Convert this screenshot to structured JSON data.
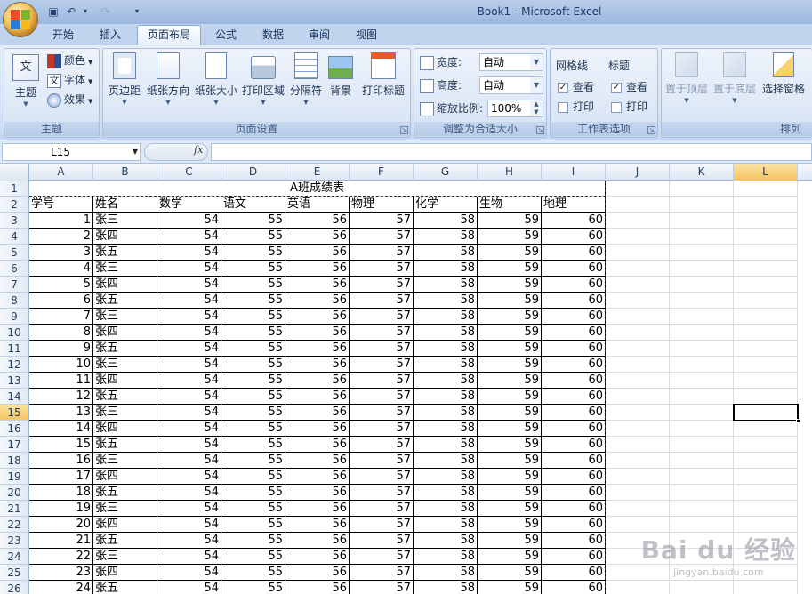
{
  "window": {
    "title": "Book1 - Microsoft Excel"
  },
  "tabs": [
    "开始",
    "插入",
    "页面布局",
    "公式",
    "数据",
    "审阅",
    "视图"
  ],
  "active_tab": "页面布局",
  "ribbon": {
    "theme_group": {
      "label": "主题",
      "theme_btn": "主题",
      "colors": "颜色",
      "fonts": "字体",
      "effects": "效果"
    },
    "page_setup": {
      "label": "页面设置",
      "margins": "页边距",
      "orientation": "纸张方向",
      "size": "纸张大小",
      "print_area": "打印区域",
      "breaks": "分隔符",
      "background": "背景",
      "print_titles": "打印标题"
    },
    "scale_fit": {
      "label": "调整为合适大小",
      "width_label": "宽度:",
      "width_value": "自动",
      "height_label": "高度:",
      "height_value": "自动",
      "scale_label": "缩放比例:",
      "scale_value": "100%"
    },
    "sheet_options": {
      "label": "工作表选项",
      "gridlines": "网格线",
      "headings": "标题",
      "view": "查看",
      "print": "打印"
    },
    "arrange": {
      "label": "排列",
      "bring_front": "置于顶层",
      "send_back": "置于底层",
      "selection_pane": "选择窗格"
    }
  },
  "formula_bar": {
    "name_box": "L15",
    "fx": "fx",
    "content": ""
  },
  "columns": [
    "A",
    "B",
    "C",
    "D",
    "E",
    "F",
    "G",
    "H",
    "I",
    "J",
    "K",
    "L"
  ],
  "selected_column": "L",
  "selected_row": "15",
  "sheet": {
    "title": "A班成绩表",
    "headers": [
      "学号",
      "姓名",
      "数学",
      "语文",
      "英语",
      "物理",
      "化学",
      "生物",
      "地理"
    ],
    "rows": [
      [
        "1",
        "张三",
        "54",
        "55",
        "56",
        "57",
        "58",
        "59",
        "60"
      ],
      [
        "2",
        "张四",
        "54",
        "55",
        "56",
        "57",
        "58",
        "59",
        "60"
      ],
      [
        "3",
        "张五",
        "54",
        "55",
        "56",
        "57",
        "58",
        "59",
        "60"
      ],
      [
        "4",
        "张三",
        "54",
        "55",
        "56",
        "57",
        "58",
        "59",
        "60"
      ],
      [
        "5",
        "张四",
        "54",
        "55",
        "56",
        "57",
        "58",
        "59",
        "60"
      ],
      [
        "6",
        "张五",
        "54",
        "55",
        "56",
        "57",
        "58",
        "59",
        "60"
      ],
      [
        "7",
        "张三",
        "54",
        "55",
        "56",
        "57",
        "58",
        "59",
        "60"
      ],
      [
        "8",
        "张四",
        "54",
        "55",
        "56",
        "57",
        "58",
        "59",
        "60"
      ],
      [
        "9",
        "张五",
        "54",
        "55",
        "56",
        "57",
        "58",
        "59",
        "60"
      ],
      [
        "10",
        "张三",
        "54",
        "55",
        "56",
        "57",
        "58",
        "59",
        "60"
      ],
      [
        "11",
        "张四",
        "54",
        "55",
        "56",
        "57",
        "58",
        "59",
        "60"
      ],
      [
        "12",
        "张五",
        "54",
        "55",
        "56",
        "57",
        "58",
        "59",
        "60"
      ],
      [
        "13",
        "张三",
        "54",
        "55",
        "56",
        "57",
        "58",
        "59",
        "60"
      ],
      [
        "14",
        "张四",
        "54",
        "55",
        "56",
        "57",
        "58",
        "59",
        "60"
      ],
      [
        "15",
        "张五",
        "54",
        "55",
        "56",
        "57",
        "58",
        "59",
        "60"
      ],
      [
        "16",
        "张三",
        "54",
        "55",
        "56",
        "57",
        "58",
        "59",
        "60"
      ],
      [
        "17",
        "张四",
        "54",
        "55",
        "56",
        "57",
        "58",
        "59",
        "60"
      ],
      [
        "18",
        "张五",
        "54",
        "55",
        "56",
        "57",
        "58",
        "59",
        "60"
      ],
      [
        "19",
        "张三",
        "54",
        "55",
        "56",
        "57",
        "58",
        "59",
        "60"
      ],
      [
        "20",
        "张四",
        "54",
        "55",
        "56",
        "57",
        "58",
        "59",
        "60"
      ],
      [
        "21",
        "张五",
        "54",
        "55",
        "56",
        "57",
        "58",
        "59",
        "60"
      ],
      [
        "22",
        "张三",
        "54",
        "55",
        "56",
        "57",
        "58",
        "59",
        "60"
      ],
      [
        "23",
        "张四",
        "54",
        "55",
        "56",
        "57",
        "58",
        "59",
        "60"
      ],
      [
        "24",
        "张五",
        "54",
        "55",
        "56",
        "57",
        "58",
        "59",
        "60"
      ]
    ]
  },
  "watermark": {
    "brand": "Bai du 经验",
    "url": "jingyan.baidu.com"
  },
  "colors": {
    "accent": "#f5c55f",
    "ribbon": "#dbe6f5",
    "header": "#e2eaf4"
  }
}
